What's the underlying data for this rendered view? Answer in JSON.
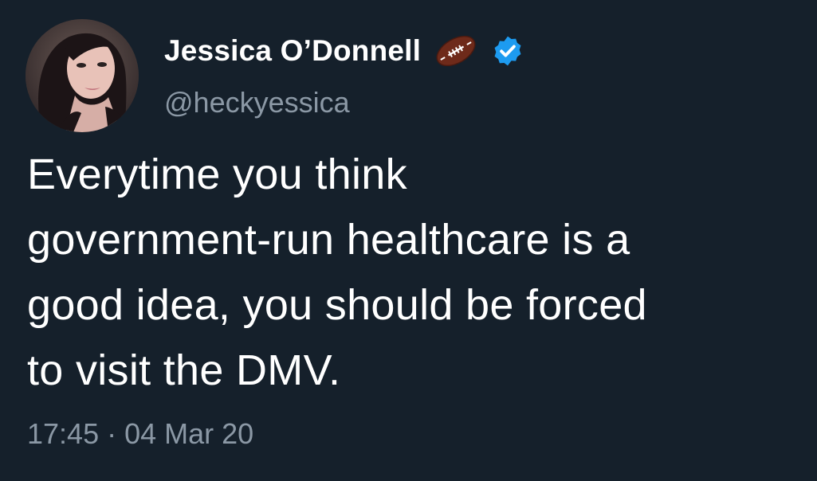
{
  "author": {
    "display_name": "Jessica O’Donnell",
    "handle": "@heckyessica",
    "badges": [
      "football-icon",
      "verified-icon"
    ],
    "verified_color": "#1d9bf0"
  },
  "tweet": {
    "lines": [
      "Everytime you think",
      "government-run healthcare is a",
      "good idea, you should be forced",
      "to visit the DMV."
    ],
    "time": "17:45",
    "separator": "·",
    "date": "04 Mar 20"
  },
  "colors": {
    "background": "#15202b",
    "text": "#ffffff",
    "secondary": "#8b98a5"
  }
}
